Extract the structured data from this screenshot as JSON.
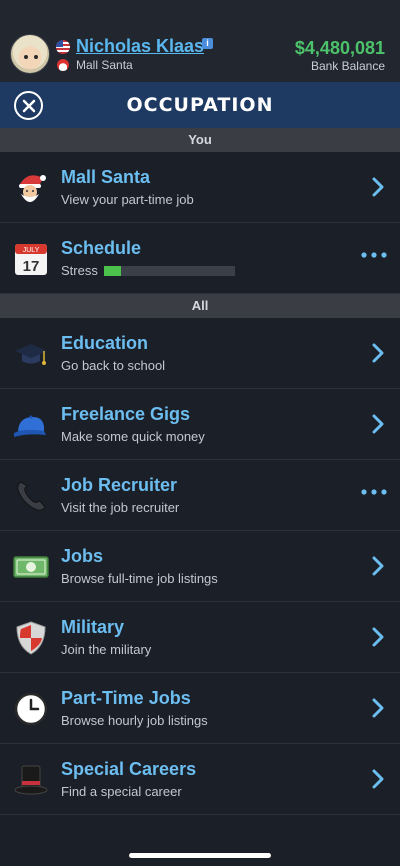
{
  "header": {
    "player_name": "Nicholas Klaas",
    "player_job": "Mall Santa",
    "balance": "$4,480,081",
    "balance_label": "Bank Balance",
    "info_badge": "i"
  },
  "titlebar": {
    "title": "OCCUPATION"
  },
  "sections": {
    "you": "You",
    "all": "All"
  },
  "rows": [
    {
      "label": "Mall Santa",
      "sub": "View your part-time job",
      "icon": "santa-icon",
      "action": "chevron"
    },
    {
      "label": "Schedule",
      "sub": "Stress",
      "icon": "calendar-icon",
      "action": "more",
      "calendar_month": "JULY",
      "calendar_day": "17",
      "stress_level": 0.13
    },
    {
      "label": "Education",
      "sub": "Go back to school",
      "icon": "graduation-cap-icon",
      "action": "chevron"
    },
    {
      "label": "Freelance Gigs",
      "sub": "Make some quick money",
      "icon": "cap-icon",
      "action": "chevron"
    },
    {
      "label": "Job Recruiter",
      "sub": "Visit the job recruiter",
      "icon": "phone-icon",
      "action": "more"
    },
    {
      "label": "Jobs",
      "sub": "Browse full-time job listings",
      "icon": "money-icon",
      "action": "chevron"
    },
    {
      "label": "Military",
      "sub": "Join the military",
      "icon": "shield-icon",
      "action": "chevron"
    },
    {
      "label": "Part-Time Jobs",
      "sub": "Browse hourly job listings",
      "icon": "clock-icon",
      "action": "chevron"
    },
    {
      "label": "Special Careers",
      "sub": "Find a special career",
      "icon": "top-hat-icon",
      "action": "chevron"
    }
  ],
  "colors": {
    "accent": "#6cbdf0",
    "balance": "#4cc36a",
    "titlebar": "#1e3a63",
    "stress": "#4cc24c"
  }
}
